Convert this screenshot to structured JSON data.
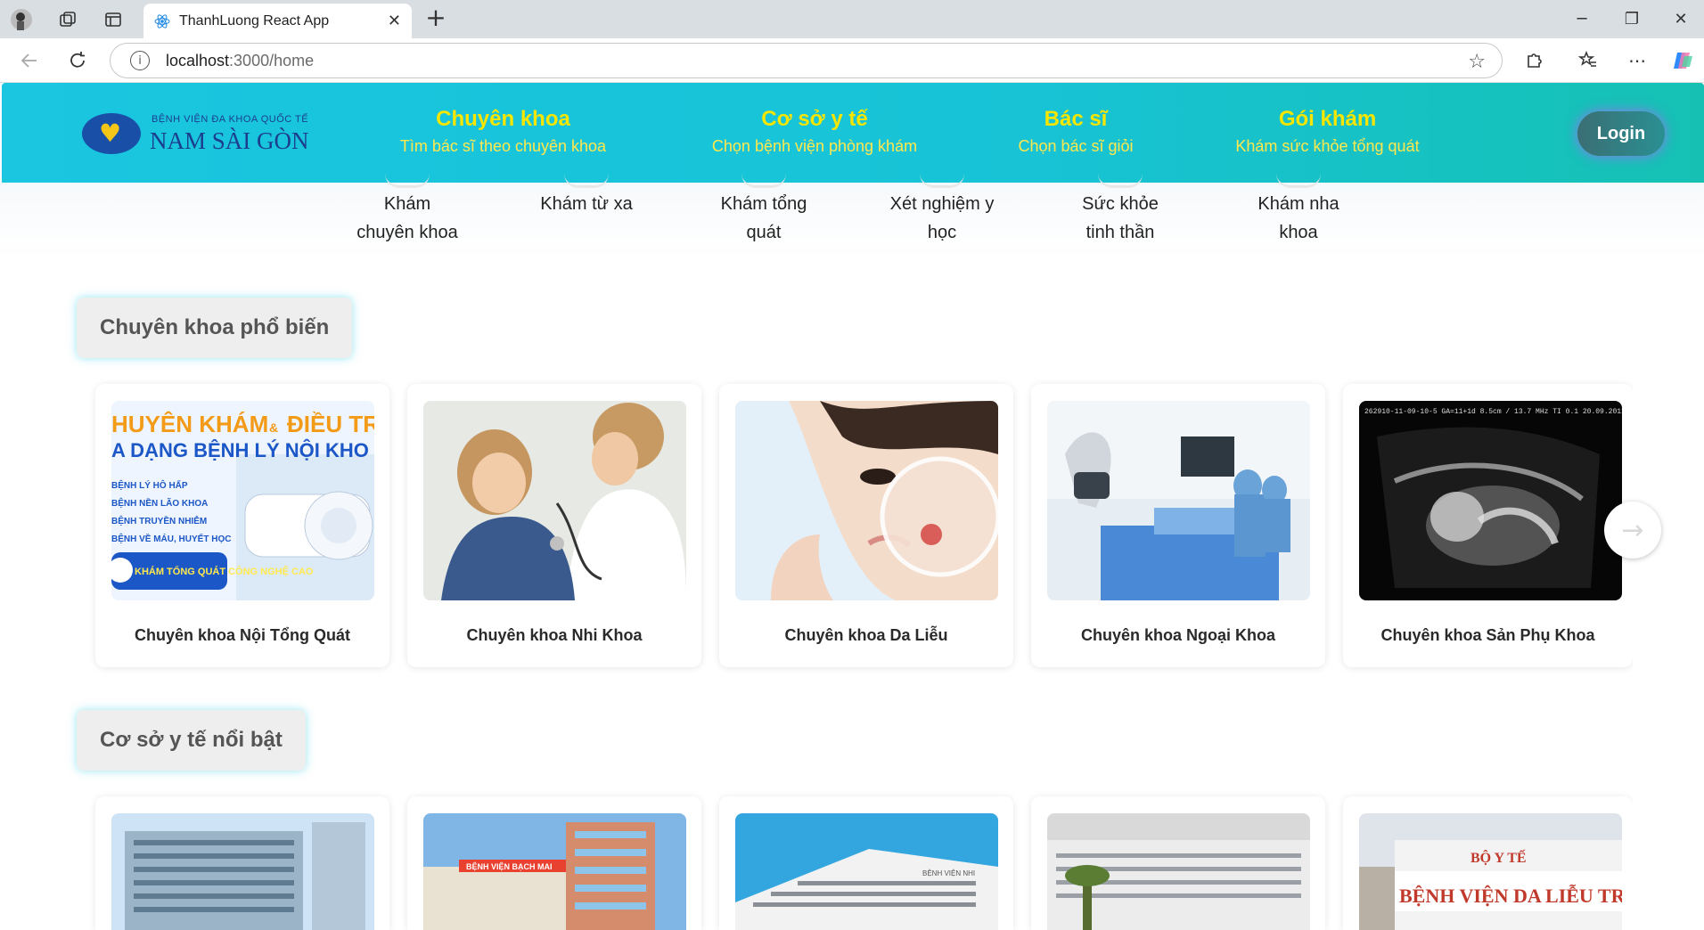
{
  "browser": {
    "tab_title": "ThanhLuong React App",
    "url_host": "localhost",
    "url_path": ":3000/home",
    "new_tab_glyph": "+",
    "close_tab_glyph": "✕"
  },
  "header": {
    "logo_small": "BỆNH VIỆN ĐA KHOA QUỐC TẾ",
    "logo_big": "NAM SÀI GÒN",
    "menu": [
      {
        "title": "Chuyên khoa",
        "subtitle": "Tìm bác sĩ theo chuyên khoa"
      },
      {
        "title": "Cơ sở y tế",
        "subtitle": "Chọn bệnh viện phòng khám"
      },
      {
        "title": "Bác sĩ",
        "subtitle": "Chọn bác sĩ giỏi"
      },
      {
        "title": "Gói khám",
        "subtitle": "Khám sức khỏe tổng quát"
      }
    ],
    "login_label": "Login"
  },
  "services": [
    {
      "line1": "Khám",
      "line2": "chuyên khoa"
    },
    {
      "line1": "Khám từ xa",
      "line2": ""
    },
    {
      "line1": "Khám tổng",
      "line2": "quát"
    },
    {
      "line1": "Xét nghiệm y",
      "line2": "học"
    },
    {
      "line1": "Sức khỏe",
      "line2": "tinh thần"
    },
    {
      "line1": "Khám nha",
      "line2": "khoa"
    }
  ],
  "specialties": {
    "title": "Chuyên khoa phổ biến",
    "items": [
      {
        "label": "Chuyên khoa Nội Tổng Quát",
        "promo_line1": "HUYÊN KHÁM",
        "promo_amp": "&",
        "promo_line1b": "ĐIỀU TR",
        "promo_line2": "A DẠNG BỆNH LÝ NỘI KHO",
        "promo_list": [
          "BỆNH LÝ HÔ HẤP",
          "BỆNH NỀN LÃO KHOA",
          "BỆNH TRUYỀN NHIỄM",
          "BỆNH VỀ MÁU, HUYẾT HỌC"
        ],
        "promo_box": "KHÁM TỔNG QUÁT CÔNG NGHỆ CAO"
      },
      {
        "label": "Chuyên khoa Nhi Khoa"
      },
      {
        "label": "Chuyên khoa Da Liễu"
      },
      {
        "label": "Chuyên khoa Ngoại Khoa"
      },
      {
        "label": "Chuyên khoa Sản Phụ Khoa"
      }
    ]
  },
  "facilities": {
    "title": "Cơ sở y tế nổi bật",
    "signs": [
      "BỆNH VIỆN BẠCH MAI",
      "BỆNH VIỆN NHI",
      "BỘ Y TẾ",
      "BỆNH VIỆN DA LIỄU TRUNG ƯƠNG"
    ]
  },
  "icons": {
    "next": "arrow-right-icon",
    "accent": "#1ac6e0",
    "menu_title_color": "#f7e600"
  }
}
